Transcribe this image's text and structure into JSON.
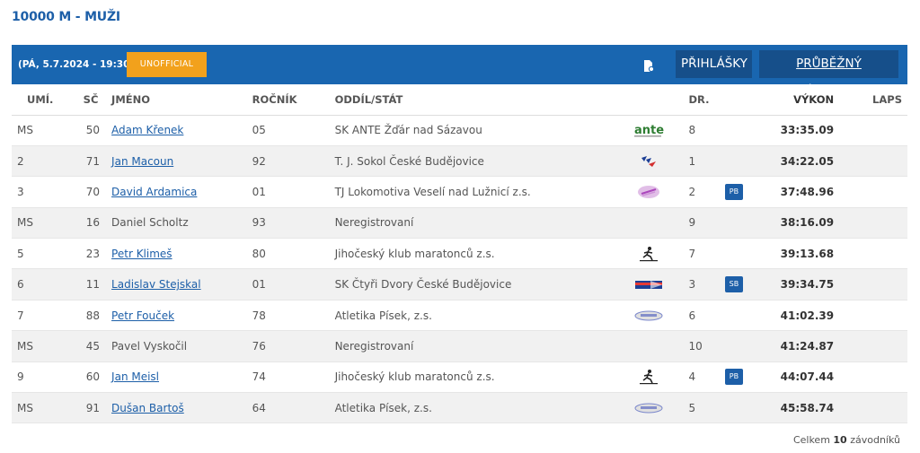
{
  "title": "10000 M - MUŽI",
  "header": {
    "date_time": "(PÁ, 5.7.2024 - 19:30)",
    "status": "UNOFFICIAL",
    "entries_label": "PŘIHLÁŠKY",
    "results_label": "PRŮBĚŽNÝ VÝSLEDEK",
    "icon": "document-icon"
  },
  "columns": {
    "rank": "UMÍ.",
    "bib": "SČ",
    "name": "JMÉNO",
    "year": "ROČNÍK",
    "club": "ODDÍL/STÁT",
    "lane": "DR.",
    "performance": "VÝKON",
    "laps": "LAPS"
  },
  "rows": [
    {
      "rank": "MS",
      "bib": "50",
      "name": "Adam Křenek",
      "linked": true,
      "year": "05",
      "club": "SK ANTE Žďár nad Sázavou",
      "logo": "ante",
      "lane": "8",
      "note": "",
      "performance": "33:35.09"
    },
    {
      "rank": "2",
      "bib": "71",
      "name": "Jan Macoun",
      "linked": true,
      "year": "92",
      "club": "T. J. Sokol České Budějovice",
      "logo": "sokol",
      "lane": "1",
      "note": "",
      "performance": "34:22.05"
    },
    {
      "rank": "3",
      "bib": "70",
      "name": "David Ardamica",
      "linked": true,
      "year": "01",
      "club": "TJ Lokomotiva Veselí nad Lužnicí z.s.",
      "logo": "lokomotiva",
      "lane": "2",
      "note": "PB",
      "performance": "37:48.96"
    },
    {
      "rank": "MS",
      "bib": "16",
      "name": "Daniel Scholtz",
      "linked": false,
      "year": "93",
      "club": "Neregistrovaní",
      "logo": "",
      "lane": "9",
      "note": "",
      "performance": "38:16.09"
    },
    {
      "rank": "5",
      "bib": "23",
      "name": "Petr Klimeš",
      "linked": true,
      "year": "80",
      "club": "Jihočeský klub maratonců z.s.",
      "logo": "runner",
      "lane": "7",
      "note": "",
      "performance": "39:13.68"
    },
    {
      "rank": "6",
      "bib": "11",
      "name": "Ladislav Stejskal",
      "linked": true,
      "year": "01",
      "club": "SK Čtyři Dvory České Budějovice",
      "logo": "ctyridvory",
      "lane": "3",
      "note": "SB",
      "performance": "39:34.75"
    },
    {
      "rank": "7",
      "bib": "88",
      "name": "Petr Fouček",
      "linked": true,
      "year": "78",
      "club": "Atletika Písek, z.s.",
      "logo": "pisek",
      "lane": "6",
      "note": "",
      "performance": "41:02.39"
    },
    {
      "rank": "MS",
      "bib": "45",
      "name": "Pavel Vyskočil",
      "linked": false,
      "year": "76",
      "club": "Neregistrovaní",
      "logo": "",
      "lane": "10",
      "note": "",
      "performance": "41:24.87"
    },
    {
      "rank": "9",
      "bib": "60",
      "name": "Jan Meisl",
      "linked": true,
      "year": "74",
      "club": "Jihočeský klub maratonců z.s.",
      "logo": "runner",
      "lane": "4",
      "note": "PB",
      "performance": "44:07.44"
    },
    {
      "rank": "MS",
      "bib": "91",
      "name": "Dušan Bartoš",
      "linked": true,
      "year": "64",
      "club": "Atletika Písek, z.s.",
      "logo": "pisek",
      "lane": "5",
      "note": "",
      "performance": "45:58.74"
    }
  ],
  "footer": {
    "prefix": "Celkem",
    "count": "10",
    "suffix": "závodníků"
  },
  "colors": {
    "primary": "#1966b0",
    "button_dark": "#164f8a",
    "unofficial": "#f2a11c",
    "link": "#1d5fa8"
  }
}
